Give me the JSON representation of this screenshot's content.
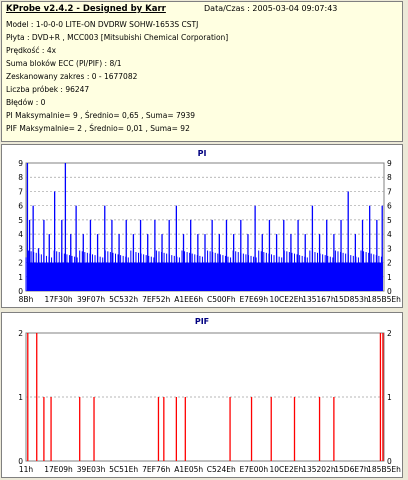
{
  "header": {
    "title": "KProbe v2.4.2 - Designed by Karr",
    "datetime": "Data/Czas : 2005-03-04 09:07:43",
    "lines": [
      "Model : 1-0-0-0 LITE-ON DVDRW SOHW-1653S CSTJ",
      "Płyta : DVD+R , MCC003 [Mitsubishi Chemical Corporation]",
      "Prędkość : 4x",
      "Suma bloków ECC (PI/PIF) : 8/1",
      "Zeskanowany zakres : 0 - 1677082",
      "Liczba próbek : 96247",
      "Błędów : 0",
      "PI Maksymalnie= 9 , Średnio= 0,65 , Suma= 7939",
      "PIF Maksymalnie= 2 , Średnio= 0,01 , Suma= 92"
    ]
  },
  "chart_data": [
    {
      "type": "bar",
      "title": "PI",
      "ylim": [
        0,
        9
      ],
      "yticks": [
        0,
        1,
        2,
        3,
        4,
        5,
        6,
        7,
        8,
        9
      ],
      "xticks": [
        "8Bh",
        "17F30h",
        "39F07h",
        "5C532h",
        "7EF52h",
        "A1EE6h",
        "C500Fh",
        "E7E69h",
        "10CE2Eh",
        "135167h",
        "15D853h",
        "185B5Eh"
      ],
      "grid": true,
      "color": "#0000ff",
      "base_level": 2,
      "spikes": [
        {
          "x": 0.004,
          "y": 9
        },
        {
          "x": 0.01,
          "y": 5
        },
        {
          "x": 0.02,
          "y": 6
        },
        {
          "x": 0.035,
          "y": 3
        },
        {
          "x": 0.05,
          "y": 5
        },
        {
          "x": 0.065,
          "y": 4
        },
        {
          "x": 0.08,
          "y": 7
        },
        {
          "x": 0.1,
          "y": 5
        },
        {
          "x": 0.11,
          "y": 9
        },
        {
          "x": 0.125,
          "y": 4
        },
        {
          "x": 0.14,
          "y": 6
        },
        {
          "x": 0.16,
          "y": 4
        },
        {
          "x": 0.18,
          "y": 5
        },
        {
          "x": 0.2,
          "y": 4
        },
        {
          "x": 0.22,
          "y": 6
        },
        {
          "x": 0.24,
          "y": 5
        },
        {
          "x": 0.26,
          "y": 4
        },
        {
          "x": 0.28,
          "y": 5
        },
        {
          "x": 0.3,
          "y": 4
        },
        {
          "x": 0.32,
          "y": 5
        },
        {
          "x": 0.34,
          "y": 4
        },
        {
          "x": 0.36,
          "y": 5
        },
        {
          "x": 0.38,
          "y": 4
        },
        {
          "x": 0.4,
          "y": 5
        },
        {
          "x": 0.42,
          "y": 6
        },
        {
          "x": 0.44,
          "y": 4
        },
        {
          "x": 0.46,
          "y": 5
        },
        {
          "x": 0.48,
          "y": 4
        },
        {
          "x": 0.5,
          "y": 4
        },
        {
          "x": 0.52,
          "y": 5
        },
        {
          "x": 0.54,
          "y": 4
        },
        {
          "x": 0.56,
          "y": 5
        },
        {
          "x": 0.58,
          "y": 4
        },
        {
          "x": 0.6,
          "y": 5
        },
        {
          "x": 0.62,
          "y": 4
        },
        {
          "x": 0.64,
          "y": 6
        },
        {
          "x": 0.66,
          "y": 4
        },
        {
          "x": 0.68,
          "y": 5
        },
        {
          "x": 0.7,
          "y": 4
        },
        {
          "x": 0.72,
          "y": 5
        },
        {
          "x": 0.74,
          "y": 4
        },
        {
          "x": 0.76,
          "y": 5
        },
        {
          "x": 0.78,
          "y": 4
        },
        {
          "x": 0.8,
          "y": 6
        },
        {
          "x": 0.82,
          "y": 4
        },
        {
          "x": 0.84,
          "y": 5
        },
        {
          "x": 0.86,
          "y": 4
        },
        {
          "x": 0.88,
          "y": 5
        },
        {
          "x": 0.9,
          "y": 7
        },
        {
          "x": 0.92,
          "y": 4
        },
        {
          "x": 0.94,
          "y": 5
        },
        {
          "x": 0.96,
          "y": 6
        },
        {
          "x": 0.98,
          "y": 5
        },
        {
          "x": 0.995,
          "y": 6
        }
      ]
    },
    {
      "type": "bar",
      "title": "PIF",
      "ylim": [
        0,
        2
      ],
      "yticks": [
        0,
        1,
        2
      ],
      "xticks": [
        "11h",
        "17E09h",
        "39E03h",
        "5C51Eh",
        "7EF76h",
        "A1E05h",
        "C524Eh",
        "E7E00h",
        "10CE2Eh",
        "135202h",
        "15D6E7h",
        "185B5Eh"
      ],
      "grid": true,
      "color": "#ff0000",
      "spikes": [
        {
          "x": 0.005,
          "y": 2
        },
        {
          "x": 0.03,
          "y": 2
        },
        {
          "x": 0.05,
          "y": 1
        },
        {
          "x": 0.07,
          "y": 1
        },
        {
          "x": 0.15,
          "y": 1
        },
        {
          "x": 0.19,
          "y": 1
        },
        {
          "x": 0.37,
          "y": 1
        },
        {
          "x": 0.385,
          "y": 1
        },
        {
          "x": 0.42,
          "y": 1
        },
        {
          "x": 0.445,
          "y": 1
        },
        {
          "x": 0.57,
          "y": 1
        },
        {
          "x": 0.63,
          "y": 1
        },
        {
          "x": 0.685,
          "y": 1
        },
        {
          "x": 0.75,
          "y": 1
        },
        {
          "x": 0.82,
          "y": 1
        },
        {
          "x": 0.86,
          "y": 1
        },
        {
          "x": 0.99,
          "y": 2
        },
        {
          "x": 0.997,
          "y": 2
        }
      ]
    }
  ]
}
